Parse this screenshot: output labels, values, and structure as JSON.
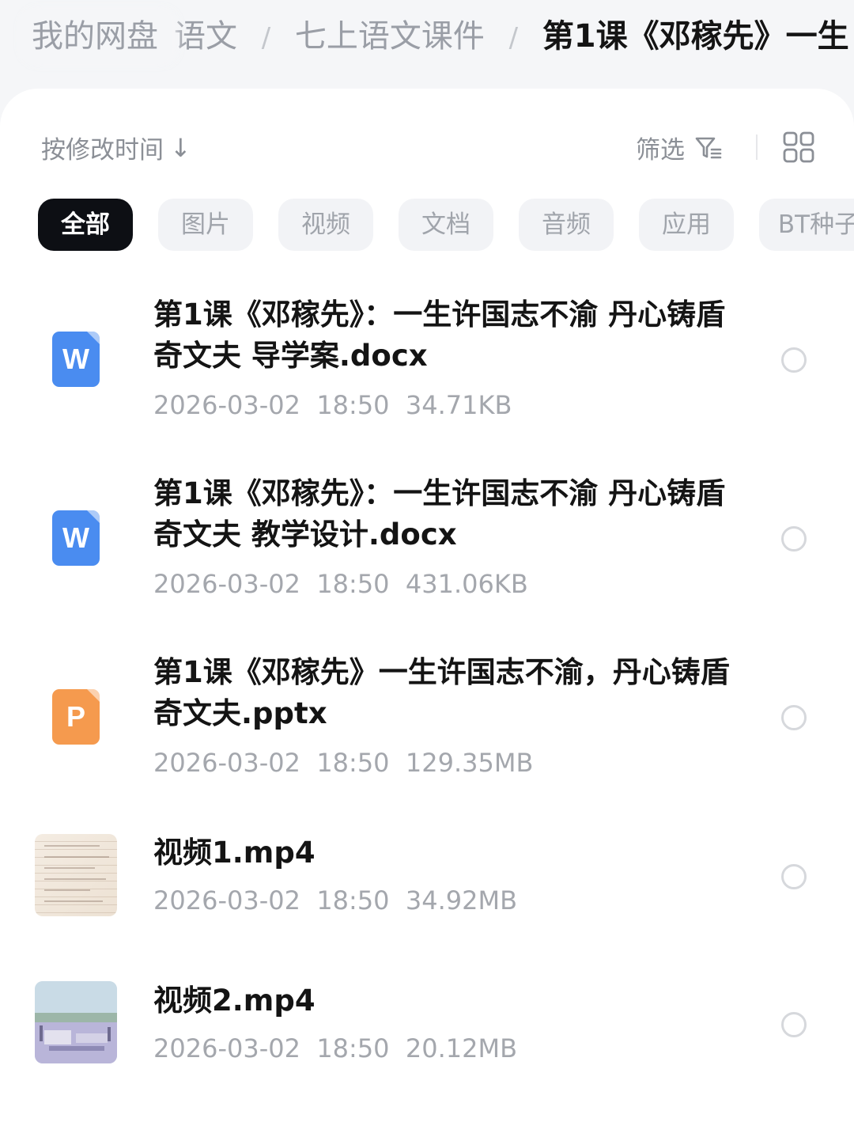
{
  "breadcrumb": {
    "root": "我的网盘",
    "separator": "/",
    "segments": [
      "语文",
      "七上语文课件",
      "第1课《邓稼先》一生"
    ]
  },
  "toolbar": {
    "sort_label": "按修改时间",
    "sort_arrow": "↓",
    "filter_label": "筛选",
    "filter_icon": "filter-icon",
    "view_icon": "grid-view-icon"
  },
  "categories": {
    "active": "全部",
    "items": [
      "全部",
      "图片",
      "视频",
      "文档",
      "音频",
      "应用",
      "BT种子"
    ]
  },
  "files": [
    {
      "name": "第1课《邓稼先》：一生许国志不渝  丹心铸盾奇文夫 导学案.docx",
      "date": "2026-03-02",
      "time": "18:50",
      "size": "34.71KB",
      "type_icon": "word-doc-icon",
      "icon_letter": "W",
      "color": "#4a8cf0"
    },
    {
      "name": "第1课《邓稼先》：一生许国志不渝  丹心铸盾奇文夫 教学设计.docx",
      "date": "2026-03-02",
      "time": "18:50",
      "size": "431.06KB",
      "type_icon": "word-doc-icon",
      "icon_letter": "W",
      "color": "#4a8cf0"
    },
    {
      "name": "第1课《邓稼先》一生许国志不渝，丹心铸盾奇文夫.pptx",
      "date": "2026-03-02",
      "time": "18:50",
      "size": "129.35MB",
      "type_icon": "ppt-doc-icon",
      "icon_letter": "P",
      "color": "#f59a4e"
    },
    {
      "name": "视频1.mp4",
      "date": "2026-03-02",
      "time": "18:50",
      "size": "34.92MB",
      "type_icon": "video-thumbnail-handwritten-page"
    },
    {
      "name": "视频2.mp4",
      "date": "2026-03-02",
      "time": "18:50",
      "size": "20.12MB",
      "type_icon": "video-thumbnail-landscape"
    }
  ],
  "colors": {
    "accent_dark": "#0d0f14",
    "word_blue": "#4a8cf0",
    "ppt_orange": "#f59a4e",
    "meta_gray": "#a4a7ad"
  }
}
